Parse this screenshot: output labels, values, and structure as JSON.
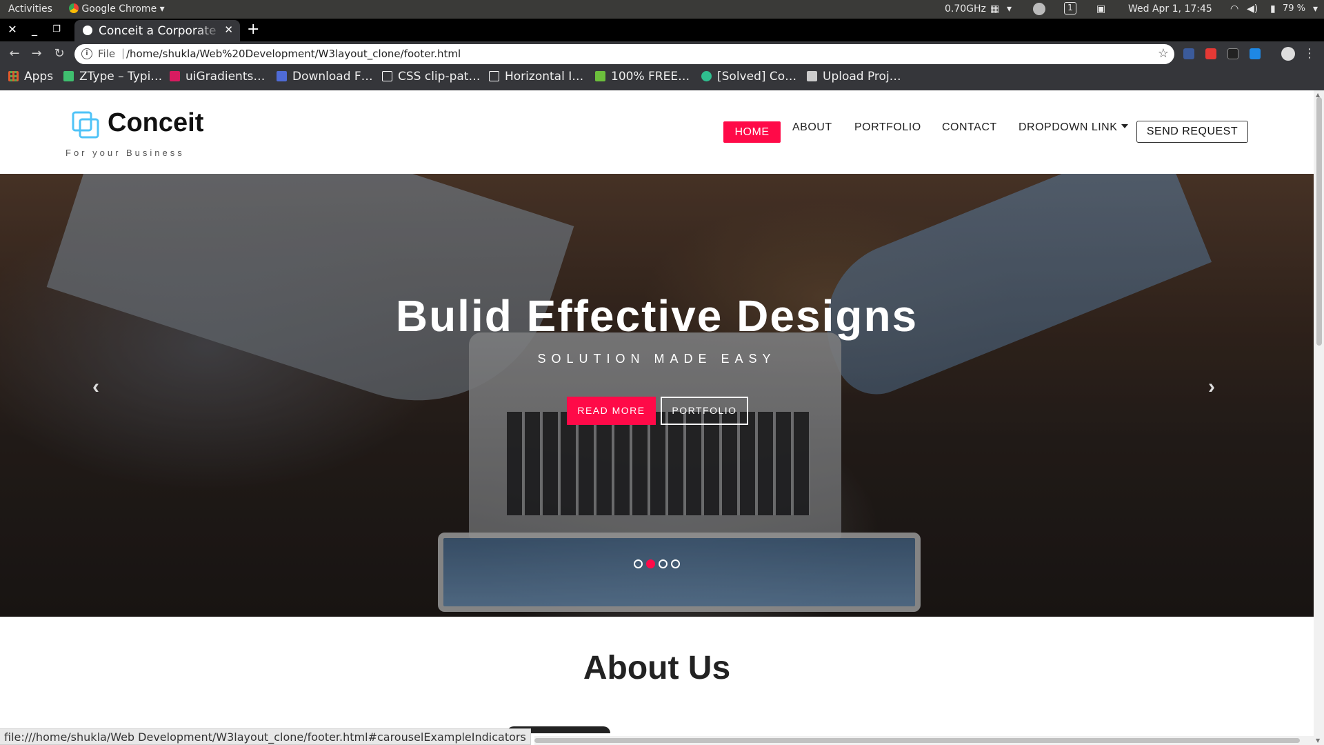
{
  "system_bar": {
    "activities": "Activities",
    "app_name": "Google Chrome",
    "cpu": "0.70GHz",
    "workspace": "1",
    "clock": "Wed Apr  1, 17:45",
    "battery": "79 %"
  },
  "browser": {
    "tab_title": "Conceit a Corporate Category",
    "url_scheme": "File",
    "url": "/home/shukla/Web%20Development/W3layout_clone/footer.html",
    "bookmarks": [
      {
        "label": "Apps",
        "icon": "apps-grid-icon",
        "color": "#e05a2b"
      },
      {
        "label": "ZType – Typi…",
        "icon": "ztype-icon",
        "color": "#3fbf6f"
      },
      {
        "label": "uiGradients…",
        "icon": "uigradients-icon",
        "color": "#d81b60"
      },
      {
        "label": "Download F…",
        "icon": "download-icon",
        "color": "#4f6bd6"
      },
      {
        "label": "CSS clip-pat…",
        "icon": "codepen-icon",
        "color": "#ffffff"
      },
      {
        "label": "Horizontal I…",
        "icon": "codepen-icon",
        "color": "#ffffff"
      },
      {
        "label": "100% FREE…",
        "icon": "leaf-icon",
        "color": "#6cbf3c"
      },
      {
        "label": "[Solved] Co…",
        "icon": "solved-icon",
        "color": "#2fbf8f"
      },
      {
        "label": "Upload Proj…",
        "icon": "tm-icon",
        "color": "#cccccc"
      }
    ]
  },
  "site": {
    "logo_name": "Conceit",
    "logo_tagline": "For your Business",
    "nav": {
      "home": "HOME",
      "about": "ABOUT",
      "portfolio": "PORTFOLIO",
      "contact": "CONTACT",
      "dropdown": "DROPDOWN LINK",
      "send_request": "SEND REQUEST"
    },
    "hero": {
      "title": "Bulid Effective Designs",
      "subtitle": "SOLUTION MADE EASY",
      "btn_primary": "READ MORE",
      "btn_secondary": "PORTFOLIO",
      "slides_total": 4,
      "active_slide": 2
    },
    "section_title": "About Us"
  },
  "status_url": "file:///home/shukla/Web Development/W3layout_clone/footer.html#carouselExampleIndicators",
  "colors": {
    "accent": "#ff0a48",
    "logo_blue": "#4fc3f7"
  }
}
